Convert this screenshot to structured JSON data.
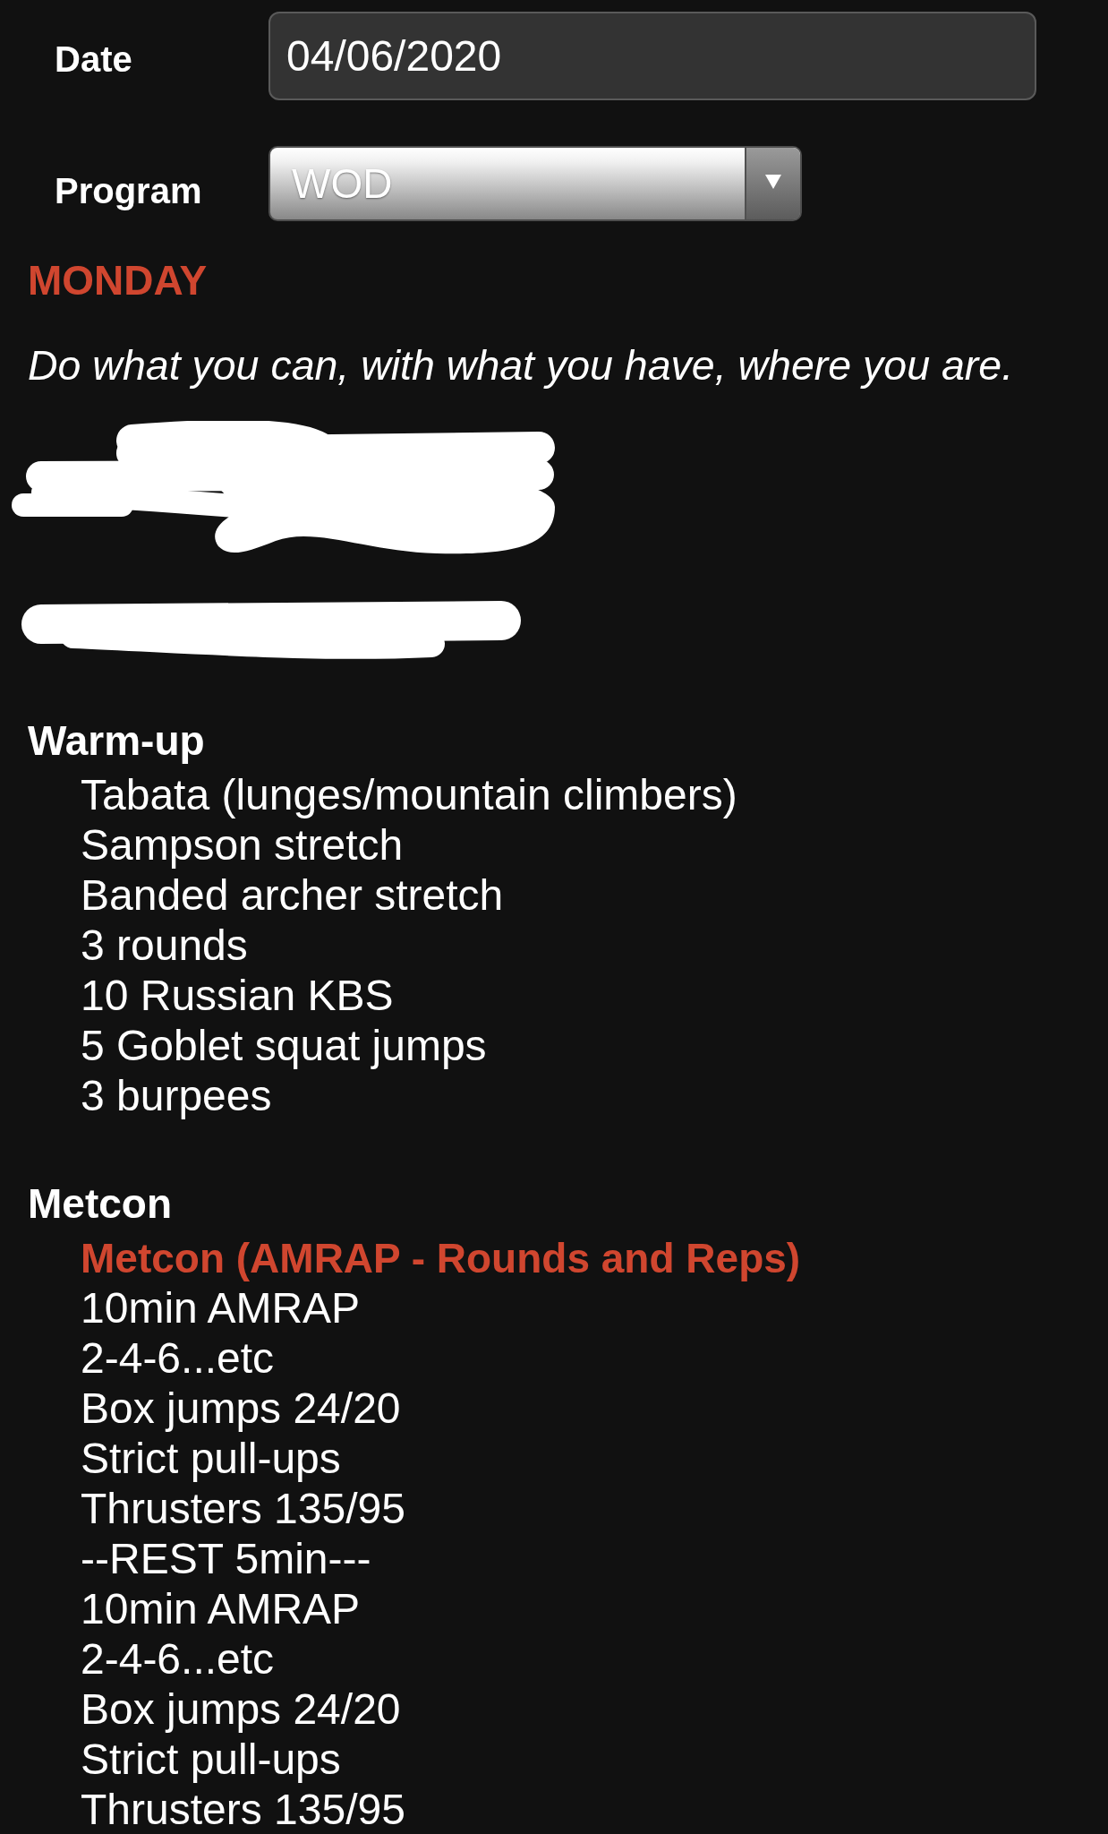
{
  "form": {
    "fields": [
      {
        "kind": "text",
        "label": "Date",
        "value": "04/06/2020"
      },
      {
        "kind": "select",
        "label": "Program",
        "value": "WOD"
      }
    ]
  },
  "day": {
    "title": "MONDAY",
    "quote": "Do what you can, with what you have, where you are."
  },
  "sections": [
    {
      "title": "Warm-up",
      "lines": [
        {
          "kind": "plain",
          "text": "Tabata (lunges/mountain climbers)"
        },
        {
          "kind": "plain",
          "text": "Sampson stretch"
        },
        {
          "kind": "plain",
          "text": "Banded archer stretch"
        },
        {
          "kind": "plain",
          "text": "3 rounds"
        },
        {
          "kind": "plain",
          "text": "10 Russian KBS"
        },
        {
          "kind": "plain",
          "text": "5 Goblet squat jumps"
        },
        {
          "kind": "plain",
          "text": "3 burpees"
        }
      ]
    },
    {
      "title": "Metcon",
      "lines": [
        {
          "kind": "title",
          "text": "Metcon (AMRAP - Rounds and Reps)"
        },
        {
          "kind": "plain",
          "text": "10min AMRAP"
        },
        {
          "kind": "plain",
          "text": "2-4-6...etc"
        },
        {
          "kind": "plain",
          "text": "Box jumps 24/20"
        },
        {
          "kind": "plain",
          "text": "Strict pull-ups"
        },
        {
          "kind": "plain",
          "text": "Thrusters 135/95"
        },
        {
          "kind": "plain",
          "text": "--REST 5min---"
        },
        {
          "kind": "plain",
          "text": "10min AMRAP"
        },
        {
          "kind": "plain",
          "text": "2-4-6...etc"
        },
        {
          "kind": "plain",
          "text": "Box jumps 24/20"
        },
        {
          "kind": "plain",
          "text": "Strict pull-ups"
        },
        {
          "kind": "plain",
          "text": "Thrusters 135/95"
        }
      ]
    }
  ]
}
